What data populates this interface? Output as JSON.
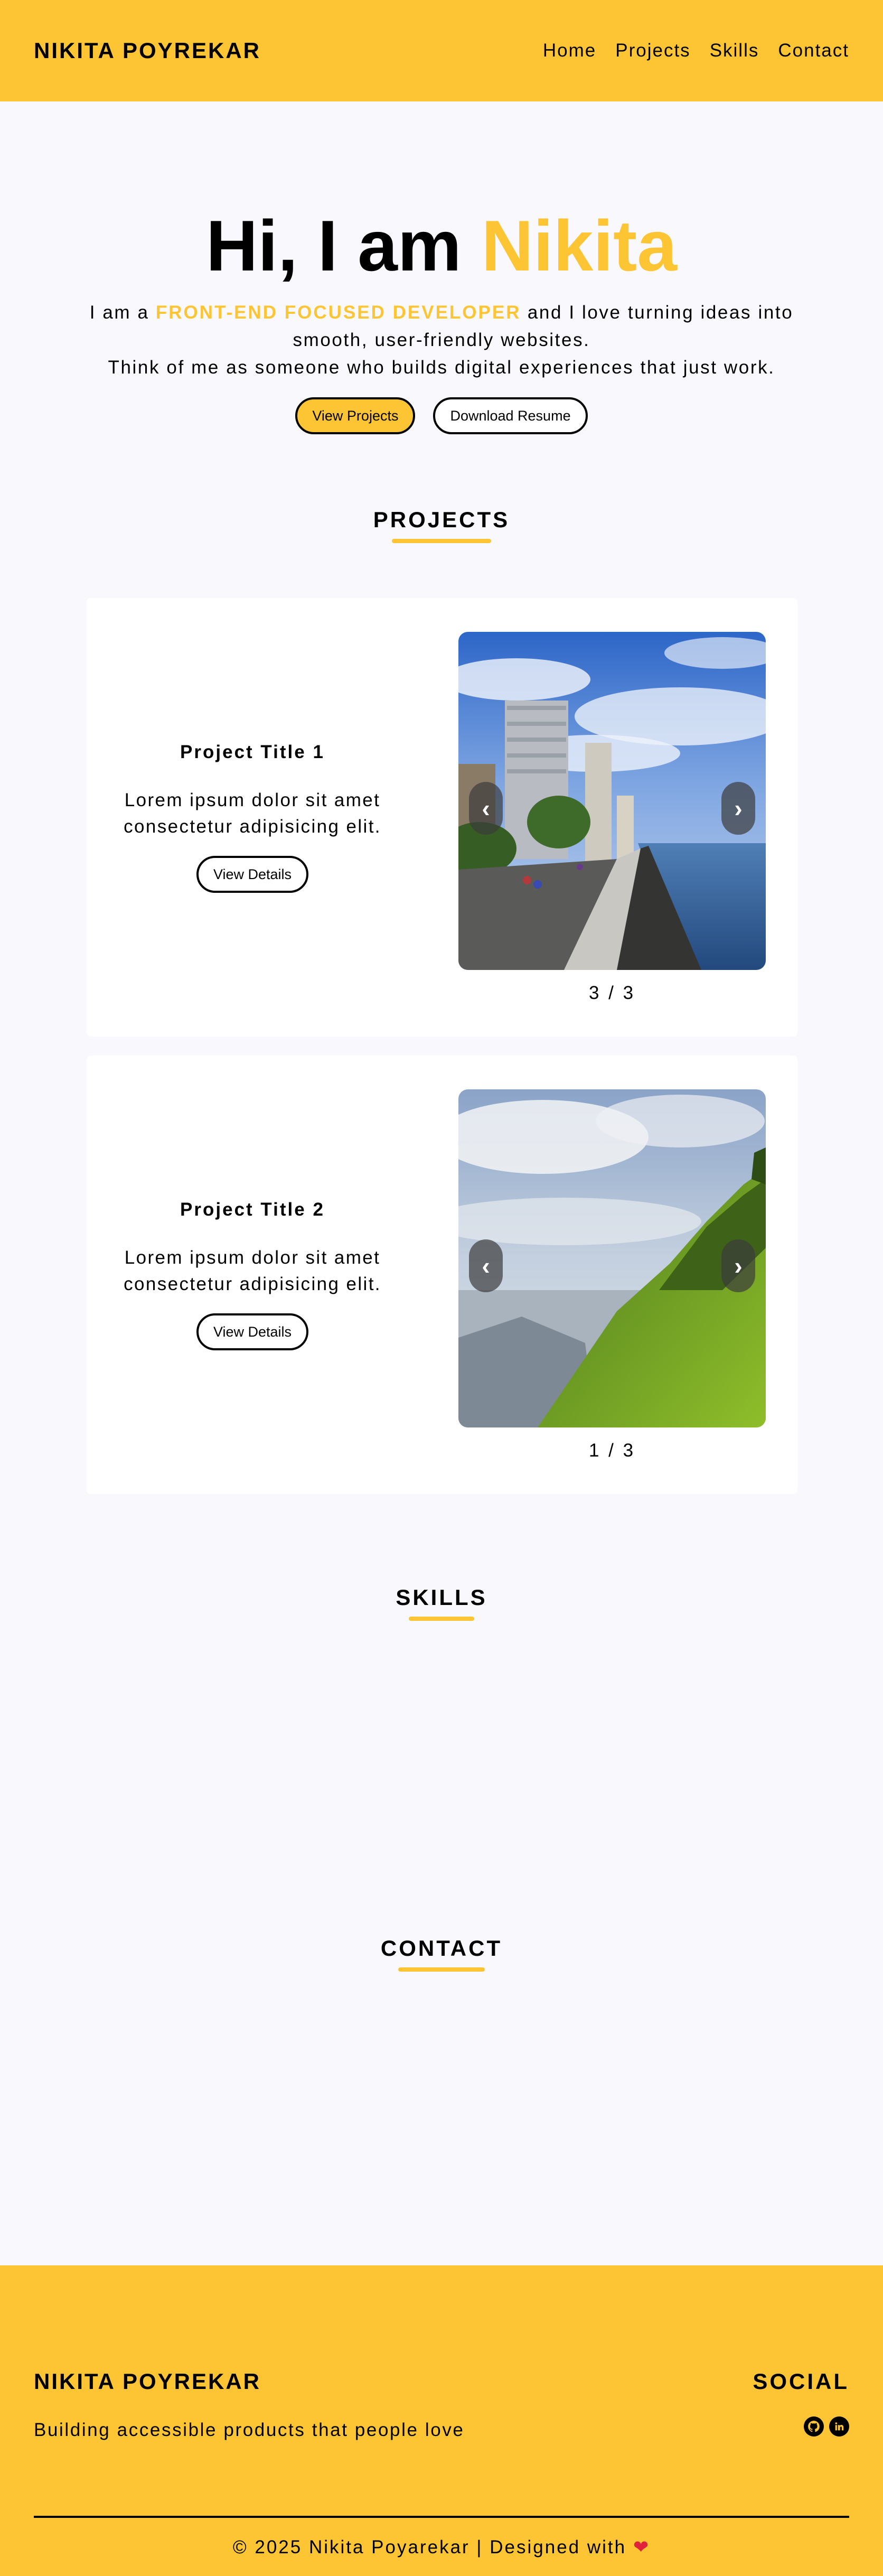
{
  "nav": {
    "brand": "NIKITA POYREKAR",
    "links": [
      {
        "label": "Home"
      },
      {
        "label": "Projects"
      },
      {
        "label": "Skills"
      },
      {
        "label": "Contact"
      }
    ]
  },
  "hero": {
    "greeting": "Hi, I am ",
    "name": "Nikita",
    "intro_prefix": "I am a ",
    "role": "FRONT-END FOCUSED DEVELOPER",
    "intro_suffix": " and I love turning ideas into smooth, user-friendly websites.",
    "line2": "Think of me as someone who builds digital experiences that just work.",
    "view_projects_label": "View Projects",
    "download_resume_label": "Download Resume"
  },
  "sections": {
    "projects": "PROJECTS",
    "skills": "SKILLS",
    "contact": "CONTACT"
  },
  "projects": [
    {
      "title": "Project Title 1",
      "description": "Lorem ipsum dolor sit amet consectetur adipisicing elit.",
      "button_label": "View Details",
      "counter": "3 / 3",
      "prev_icon": "chevron-left-icon",
      "next_icon": "chevron-right-icon"
    },
    {
      "title": "Project Title 2",
      "description": "Lorem ipsum dolor sit amet consectetur adipisicing elit.",
      "button_label": "View Details",
      "counter": "1 / 3",
      "prev_icon": "chevron-left-icon",
      "next_icon": "chevron-right-icon"
    }
  ],
  "footer": {
    "brand": "NIKITA POYREKAR",
    "tagline": "Building accessible products that people love",
    "social_heading": "SOCIAL",
    "social_icons": [
      "github-icon",
      "linkedin-icon"
    ],
    "copyright": "© 2025 Nikita Poyarekar | Designed with "
  },
  "colors": {
    "accent": "#fdc434",
    "background": "#f8f8fd",
    "heart": "#e0233a"
  }
}
